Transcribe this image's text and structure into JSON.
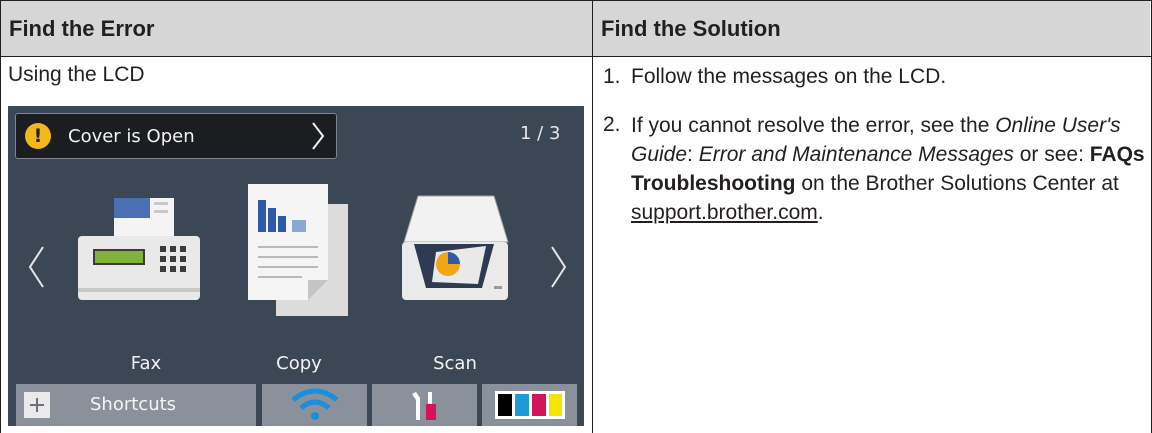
{
  "table": {
    "header_left": "Find the Error",
    "header_right": "Find the Solution",
    "left_title": "Using the LCD"
  },
  "lcd": {
    "alert_text": "Cover is Open",
    "page_indicator": "1 / 3",
    "apps": [
      {
        "label": "Fax",
        "icon": "fax-icon"
      },
      {
        "label": "Copy",
        "icon": "copy-icon"
      },
      {
        "label": "Scan",
        "icon": "scan-icon"
      }
    ],
    "shortcuts_label": "Shortcuts",
    "colors": {
      "screen": "#3c4756",
      "alert_bar": "#1b1d21",
      "warning": "#f2b81b",
      "wifi": "#1a8fdd",
      "ink_black": "#000000",
      "ink_cyan": "#1d9bd7",
      "ink_magenta": "#d4145a",
      "ink_yellow": "#f5e400"
    }
  },
  "steps": {
    "s1_num": "1.",
    "s1_text": "Follow the messages on the LCD.",
    "s2_num": "2.",
    "s2_a": "If you cannot resolve the error, see the ",
    "s2_guide": "Online User's Guide",
    "s2_colon": ": ",
    "s2_section": "Error and Maintenance Messages",
    "s2_or": " or see: ",
    "s2_faqs": "FAQs & Troubleshooting",
    "s2_on": " on the Brother Solutions Center at ",
    "s2_link": "support.brother.com",
    "s2_end": "."
  }
}
